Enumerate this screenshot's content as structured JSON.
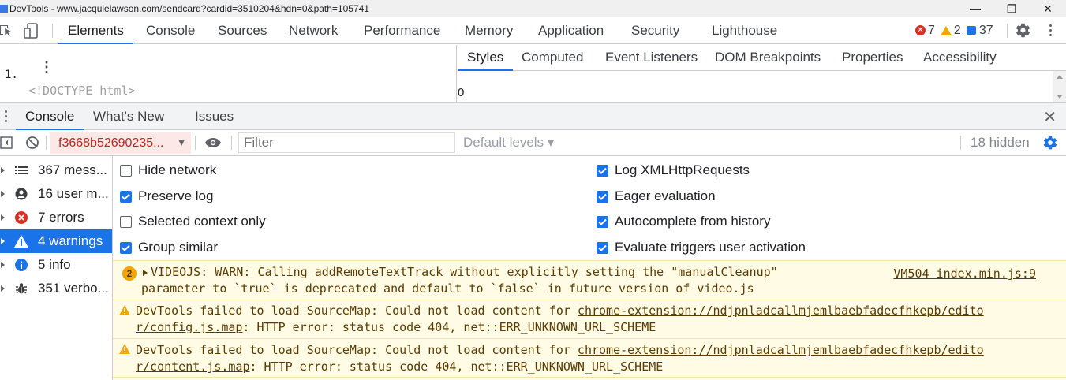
{
  "window": {
    "title": "DevTools - www.jacquielawson.com/sendcard?cardid=3510204&hdn=0&path=105741",
    "minimize": "—",
    "restore": "❐",
    "close": "✕"
  },
  "main_tabs": [
    "Elements",
    "Console",
    "Sources",
    "Network",
    "Performance",
    "Memory",
    "Application",
    "Security",
    "Lighthouse"
  ],
  "counts": {
    "errors": "7",
    "warnings": "2",
    "info": "37"
  },
  "elements": {
    "line_number": "1.",
    "doctype": "<!DOCTYPE html>"
  },
  "side_tabs": [
    "Styles",
    "Computed",
    "Event Listeners",
    "DOM Breakpoints",
    "Properties",
    "Accessibility"
  ],
  "styles_value": "0",
  "drawer_tabs": [
    "Console",
    "What's New",
    "Issues"
  ],
  "console_toolbar": {
    "context": "f3668b52690235...",
    "filter_placeholder": "Filter",
    "levels": "Default levels ▾",
    "hidden": "18 hidden"
  },
  "sidebar": [
    {
      "label": "367 mess...",
      "icon": "list-icon"
    },
    {
      "label": "16 user m...",
      "icon": "user-icon"
    },
    {
      "label": "7 errors",
      "icon": "error-icon"
    },
    {
      "label": "4 warnings",
      "icon": "warning-icon"
    },
    {
      "label": "5 info",
      "icon": "info-icon"
    },
    {
      "label": "351 verbo...",
      "icon": "bug-icon"
    }
  ],
  "settings_left": [
    {
      "label": "Hide network",
      "checked": false
    },
    {
      "label": "Preserve log",
      "checked": true
    },
    {
      "label": "Selected context only",
      "checked": false
    },
    {
      "label": "Group similar",
      "checked": true
    }
  ],
  "settings_right": [
    {
      "label": "Log XMLHttpRequests",
      "checked": true
    },
    {
      "label": "Eager evaluation",
      "checked": true
    },
    {
      "label": "Autocomplete from history",
      "checked": true
    },
    {
      "label": "Evaluate triggers user activation",
      "checked": true
    }
  ],
  "messages": [
    {
      "badge": "2",
      "line1": "VIDEOJS: WARN: Calling addRemoteTextTrack without explicitly setting the \"manualCleanup\"",
      "line2": "parameter to `true` is deprecated and default to `false` in future version of video.js",
      "source": "VM504 index.min.js:9"
    },
    {
      "line1_prefix": "DevTools failed to load SourceMap: Could not load content for ",
      "line1_link": "chrome-extension://ndjpnladcallmjemlbaebfadecfhkepb/edito",
      "line2_link": "r/config.js.map",
      "line2_suffix": ": HTTP error: status code 404, net::ERR_UNKNOWN_URL_SCHEME"
    },
    {
      "line1_prefix": "DevTools failed to load SourceMap: Could not load content for ",
      "line1_link": "chrome-extension://ndjpnladcallmjemlbaebfadecfhkepb/edito",
      "line2_link": "r/content.js.map",
      "line2_suffix": ": HTTP error: status code 404, net::ERR_UNKNOWN_URL_SCHEME"
    }
  ]
}
